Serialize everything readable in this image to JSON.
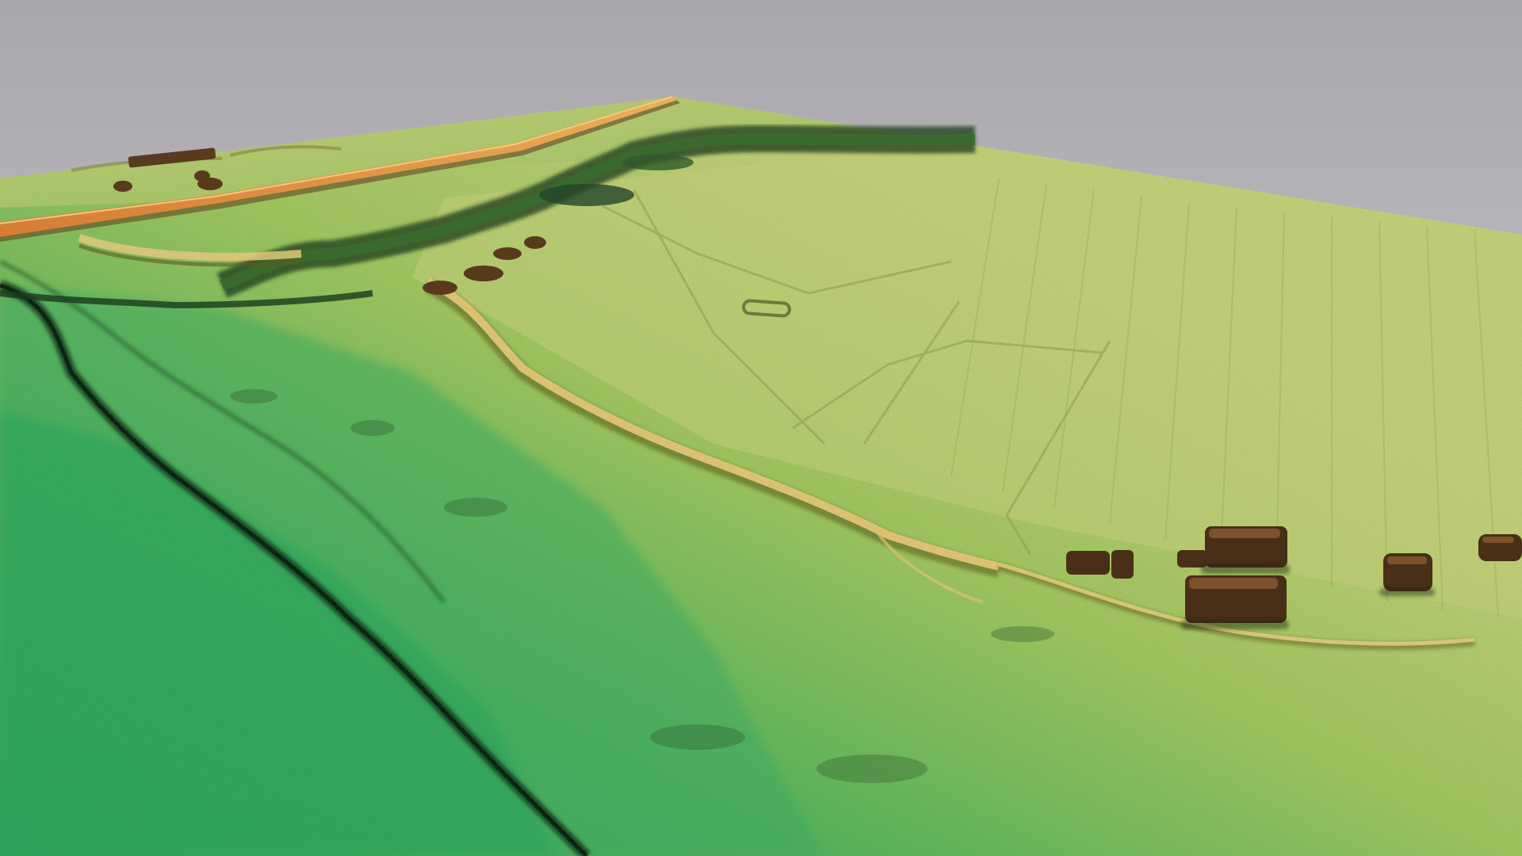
{
  "scene": {
    "kind": "lidar-terrain-hillshade-3d-view",
    "text_visible": false,
    "colors": {
      "sky_top": "#a9a7ab",
      "sky_bottom": "#d6d3d6",
      "low_ground": "#2fb36a",
      "mid_ground": "#a8cf62",
      "high_ground": "#d9dd8a",
      "ridge": "#e3c072",
      "road": "#e8a654",
      "shadow": "#1d3a1e",
      "building": "#5a3a1f"
    },
    "features": [
      "sky",
      "terrain-surface",
      "road-embankment",
      "wooded-ravine",
      "earthwork-bank",
      "lower-scarp",
      "field-boundaries",
      "plough-furrows",
      "building-cluster-foreground",
      "building-cluster-background"
    ]
  }
}
